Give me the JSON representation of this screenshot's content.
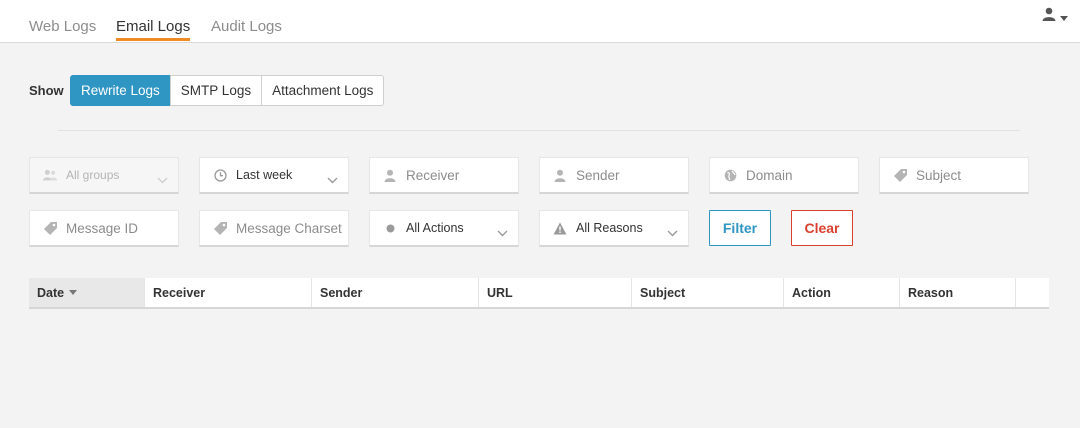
{
  "nav": {
    "tabs": [
      {
        "label": "Web Logs"
      },
      {
        "label": "Email Logs",
        "active": true
      },
      {
        "label": "Audit Logs"
      }
    ],
    "user_icon": "user-icon"
  },
  "show": {
    "label": "Show",
    "options": [
      {
        "label": "Rewrite Logs",
        "active": true
      },
      {
        "label": "SMTP Logs"
      },
      {
        "label": "Attachment Logs"
      }
    ]
  },
  "filters": {
    "groups": {
      "value": "All groups",
      "icon": "users-icon"
    },
    "period": {
      "value": "Last week",
      "icon": "clock-icon"
    },
    "receiver": {
      "placeholder": "Receiver",
      "icon": "user-icon"
    },
    "sender": {
      "placeholder": "Sender",
      "icon": "user-icon"
    },
    "domain": {
      "placeholder": "Domain",
      "icon": "globe-icon"
    },
    "subject": {
      "placeholder": "Subject",
      "icon": "tag-icon"
    },
    "message_id": {
      "placeholder": "Message ID",
      "icon": "tag-icon"
    },
    "message_charset": {
      "placeholder": "Message Charset",
      "icon": "tag-icon"
    },
    "actions": {
      "value": "All Actions",
      "icon": "dot-icon"
    },
    "reasons": {
      "value": "All Reasons",
      "icon": "warning-icon"
    },
    "filter_label": "Filter",
    "clear_label": "Clear"
  },
  "table": {
    "columns": [
      "Date",
      "Receiver",
      "Sender",
      "URL",
      "Subject",
      "Action",
      "Reason"
    ],
    "sorted_column": "Date",
    "sort_direction": "descending"
  },
  "colors": {
    "accent": "#2f95c3",
    "tab_underline": "#f08a24",
    "danger": "#d9412e",
    "background": "#f3f3f4"
  }
}
